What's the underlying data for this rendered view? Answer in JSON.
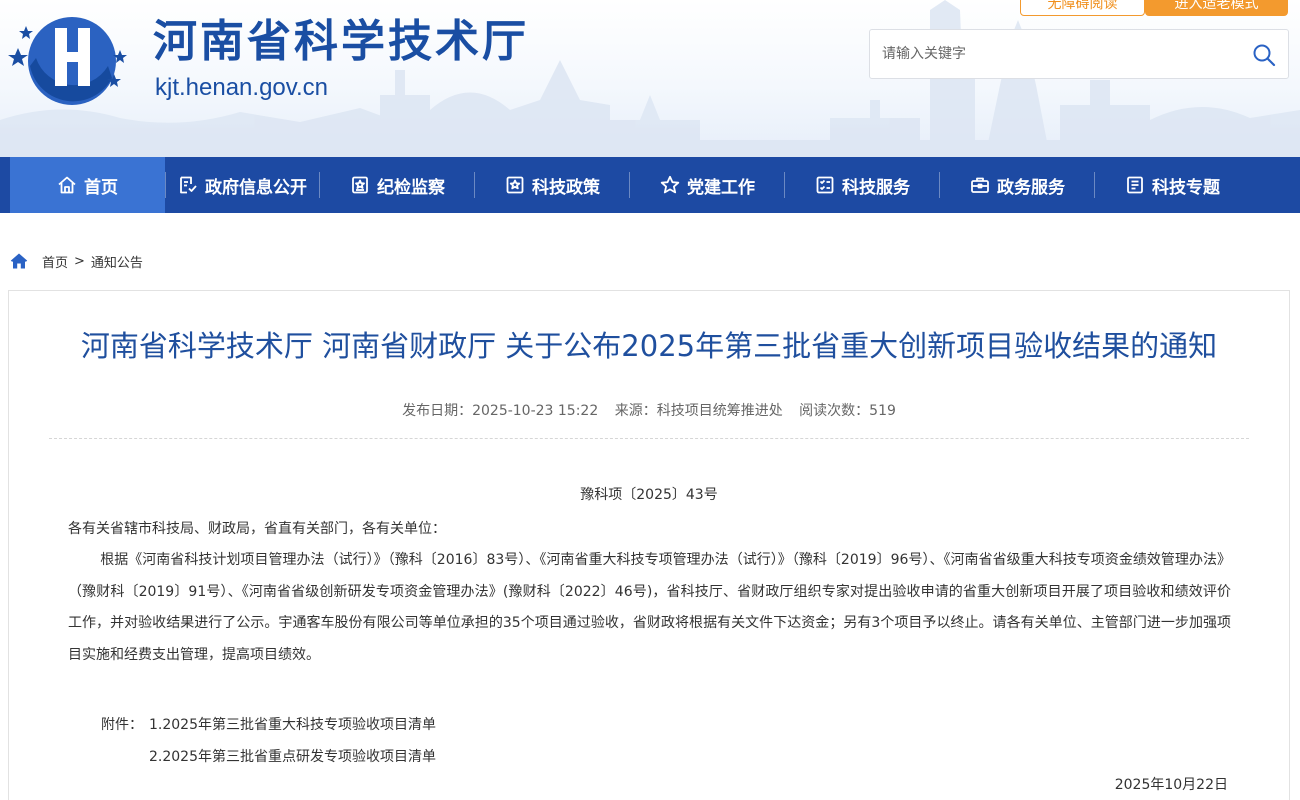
{
  "header": {
    "site_title": "河南省科学技术厅",
    "site_domain": "kjt.henan.gov.cn",
    "top_buttons": [
      "无障碍阅读",
      "进入适老模式"
    ],
    "search": {
      "placeholder": "请输入关键字",
      "value": ""
    },
    "colors": {
      "brand": "#1a4ea3",
      "accent": "#f39a2e"
    }
  },
  "nav": {
    "items": [
      {
        "label": "首页",
        "icon": "home-icon"
      },
      {
        "label": "政府信息公开",
        "icon": "info-disclosure-icon"
      },
      {
        "label": "纪检监察",
        "icon": "badge-icon"
      },
      {
        "label": "科技政策",
        "icon": "policy-icon"
      },
      {
        "label": "党建工作",
        "icon": "star-icon"
      },
      {
        "label": "科技服务",
        "icon": "checklist-icon"
      },
      {
        "label": "政务服务",
        "icon": "briefcase-icon"
      },
      {
        "label": "科技专题",
        "icon": "document-icon"
      }
    ],
    "active_index": 0,
    "colors": {
      "bar": "#1d4aa3",
      "active": "#3a73d3"
    }
  },
  "breadcrumb": {
    "home": "首页",
    "separator": ">",
    "current": "通知公告"
  },
  "article": {
    "title": "河南省科学技术厅 河南省财政厅 关于公布2025年第三批省重大创新项目验收结果的通知",
    "meta": {
      "publish_date": "发布日期：2025-10-23 15:22",
      "source": "来源：科技项目统筹推进处",
      "views": "阅读次数：519"
    },
    "doc_number": "豫科项〔2025〕43号",
    "greeting": "各有关省辖市科技局、财政局，省直有关部门，各有关单位：",
    "body": "根据《河南省科技计划项目管理办法（试行）》（豫科〔2016〕83号）、《河南省重大科技专项管理办法（试行）》（豫科〔2019〕96号）、《河南省省级重大科技专项资金绩效管理办法》（豫财科〔2019〕91号）、《河南省省级创新研发专项资金管理办法》(豫财科〔2022〕46号)，省科技厅、省财政厅组织专家对提出验收申请的省重大创新项目开展了项目验收和绩效评价工作，并对验收结果进行了公示。宇通客车股份有限公司等单位承担的35个项目通过验收，省财政将根据有关文件下达资金；另有3个项目予以终止。请各有关单位、主管部门进一步加强项目实施和经费支出管理，提高项目绩效。",
    "attachments_label": "附件：",
    "attachments": [
      "1.2025年第三批省重大科技专项验收项目清单",
      "2.2025年第三批省重点研发专项验收项目清单"
    ],
    "date": "2025年10月22日",
    "colors": {
      "title": "#1f4f9e"
    }
  }
}
